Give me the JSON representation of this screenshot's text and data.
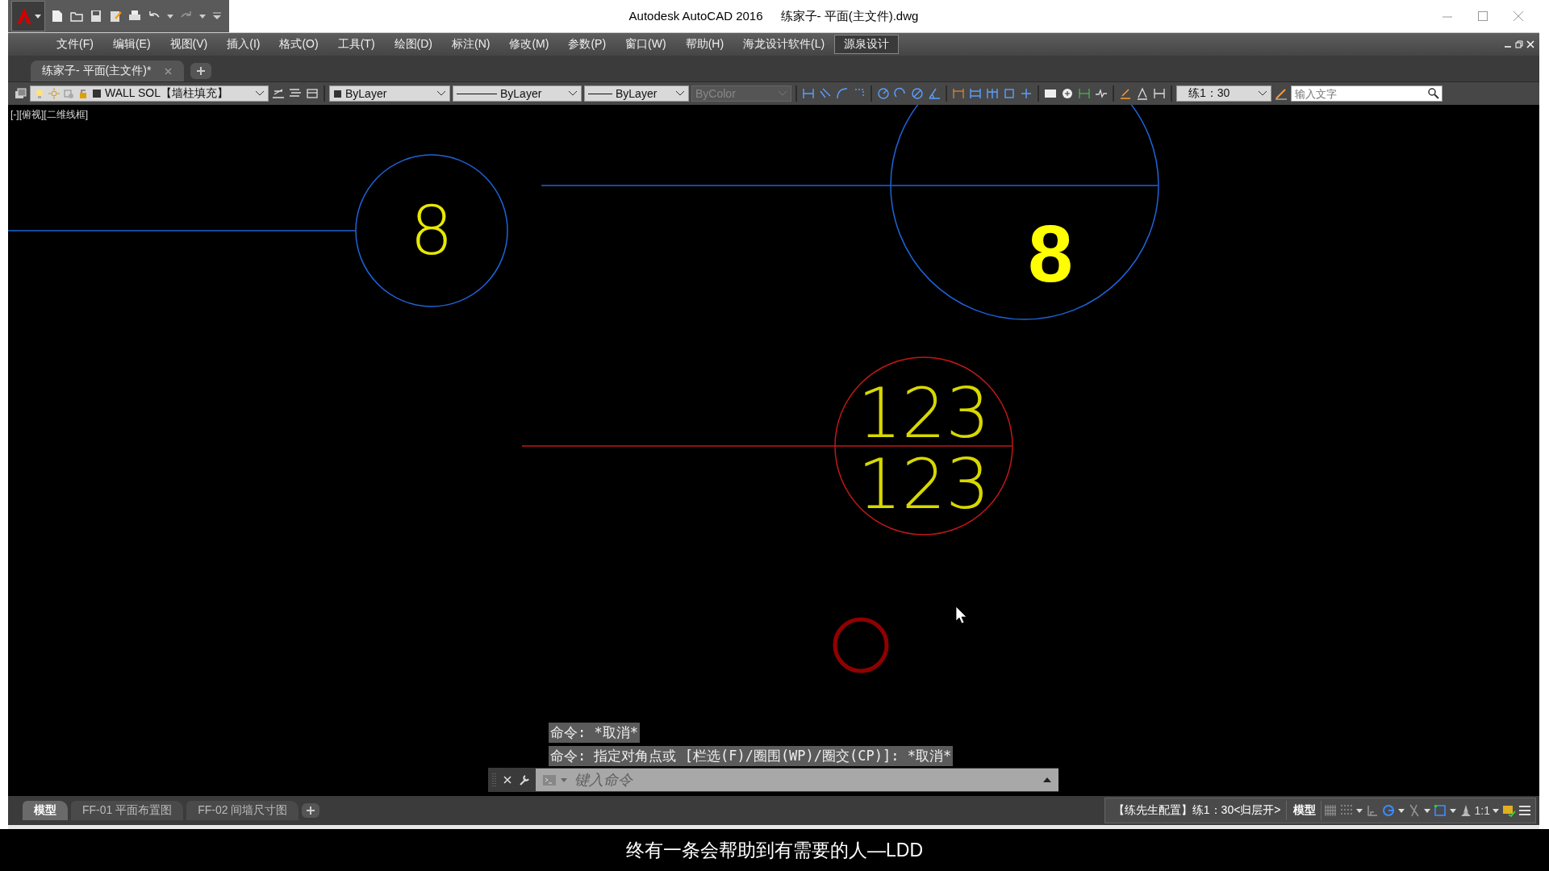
{
  "window": {
    "app_title": "Autodesk AutoCAD 2016",
    "file_title": "练家子- 平面(主文件).dwg"
  },
  "menu": [
    {
      "label": "文件(F)",
      "selected": false
    },
    {
      "label": "编辑(E)",
      "selected": false
    },
    {
      "label": "视图(V)",
      "selected": false
    },
    {
      "label": "插入(I)",
      "selected": false
    },
    {
      "label": "格式(O)",
      "selected": false
    },
    {
      "label": "工具(T)",
      "selected": false
    },
    {
      "label": "绘图(D)",
      "selected": false
    },
    {
      "label": "标注(N)",
      "selected": false
    },
    {
      "label": "修改(M)",
      "selected": false
    },
    {
      "label": "参数(P)",
      "selected": false
    },
    {
      "label": "窗口(W)",
      "selected": false
    },
    {
      "label": "帮助(H)",
      "selected": false
    },
    {
      "label": "海龙设计软件(L)",
      "selected": false
    },
    {
      "label": "源泉设计",
      "selected": true
    }
  ],
  "document_tabs": [
    {
      "label": "练家子- 平面(主文件)*",
      "selected": true
    }
  ],
  "toolbar": {
    "layer": "WALL SOL【墙柱填充】",
    "color_control": "ByLayer",
    "linetype": "ByLayer",
    "lineweight": "ByLayer",
    "plot_style": {
      "value": "ByColor",
      "disabled": true
    },
    "scale": "练1：30",
    "search": {
      "placeholder": "输入文字"
    }
  },
  "viewport_label": "[-][俯视][二维线框]",
  "drawing": {
    "labels": [
      {
        "text": "8"
      },
      {
        "text": "8"
      },
      {
        "text": "123"
      },
      {
        "text": "123"
      }
    ]
  },
  "command_history": [
    "命令: *取消*",
    "命令: 指定对角点或 [栏选(F)/圈围(WP)/圈交(CP)]: *取消*"
  ],
  "command_input": {
    "placeholder": "键入命令"
  },
  "layout_tabs": [
    {
      "label": "模型",
      "selected": true
    },
    {
      "label": "FF-01 平面布置图",
      "selected": false
    },
    {
      "label": "FF-02 间墙尺寸图",
      "selected": false
    }
  ],
  "status_bar": {
    "config": "【练先生配置】练1：30<归层开>",
    "space": "模型",
    "annotation_scale": "1:1",
    "toggles": [
      {
        "kind": "grid",
        "on": false
      },
      {
        "kind": "snap",
        "on": false
      },
      {
        "kind": "ortho",
        "on": false
      },
      {
        "kind": "polar",
        "on": true
      },
      {
        "kind": "isodraft",
        "on": false
      },
      {
        "kind": "osnap",
        "on": true
      }
    ]
  },
  "subtitle": "终有一条会帮助到有需要的人—LDD"
}
